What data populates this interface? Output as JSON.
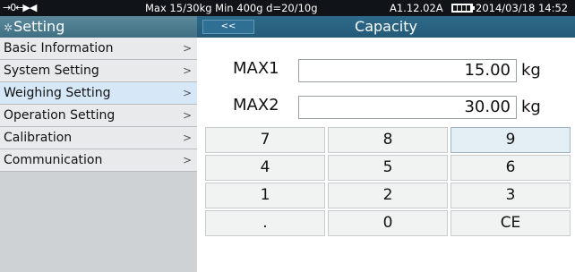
{
  "status": {
    "icons": "→0←▶◀",
    "info": "Max 15/30kg  Min 400g  d=20/10g",
    "firmware": "A1.12.02A",
    "battery_icon": "battery-icon",
    "date": "2014/03/18  14:52"
  },
  "header": {
    "title": "Setting",
    "back_label": "<<",
    "page_title": "Capacity"
  },
  "sidebar": {
    "items": [
      {
        "label": "Basic Information",
        "chevron": ">"
      },
      {
        "label": "System Setting",
        "chevron": ">"
      },
      {
        "label": "Weighing Setting",
        "chevron": ">"
      },
      {
        "label": "Operation Setting",
        "chevron": ">"
      },
      {
        "label": "Calibration",
        "chevron": ">"
      },
      {
        "label": "Communication",
        "chevron": ">"
      }
    ],
    "active_index": 2
  },
  "fields": {
    "max1": {
      "label": "MAX1",
      "value": "15.00",
      "unit": "kg"
    },
    "max2": {
      "label": "MAX2",
      "value": "30.00",
      "unit": "kg"
    }
  },
  "keypad": {
    "keys": [
      "7",
      "8",
      "9",
      "4",
      "5",
      "6",
      "1",
      "2",
      "3",
      ".",
      "0",
      "CE"
    ],
    "highlighted": "9"
  },
  "colors": {
    "status_bg": "#101418",
    "header_left_bg": "#4f7f92",
    "header_right_bg": "#2a6382",
    "active_item_bg": "#d6e8f7"
  }
}
